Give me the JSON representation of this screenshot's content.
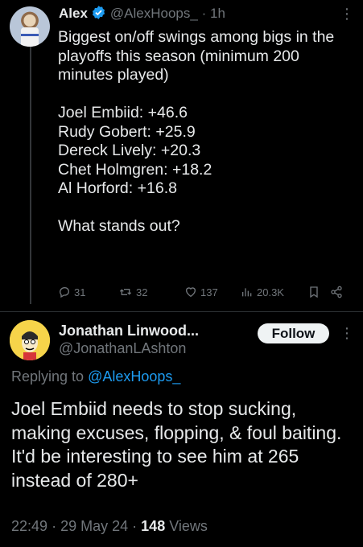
{
  "tweet": {
    "author_name": "Alex",
    "author_handle": "@AlexHoops_",
    "separator": "·",
    "time": "1h",
    "text_intro": "Biggest on/off swings among bigs in the playoffs this season (minimum 200 minutes played)",
    "list": [
      "Joel Embiid: +46.6",
      "Rudy Gobert: +25.9",
      "Dereck Lively: +20.3",
      "Chet Holmgren: +18.2",
      "Al Horford: +16.8"
    ],
    "text_outro": "What stands out?",
    "stats": {
      "replies": "31",
      "reposts": "32",
      "likes": "137",
      "views": "20.3K"
    }
  },
  "reply": {
    "author_name": "Jonathan Linwood...",
    "author_handle": "@JonathanLAshton",
    "follow_label": "Follow",
    "replying_to_prefix": "Replying to ",
    "replying_to_handle": "@AlexHoops_",
    "text": "Joel Embiid needs to stop sucking, making excuses, flopping, & foul baiting. It'd be interesting to see him at 265 instead of 280+",
    "time": "22:49",
    "separator": "·",
    "date": "29 May 24",
    "views_count": "148",
    "views_label": "Views"
  },
  "colors": {
    "background": "#000000",
    "text": "#e7e9ea",
    "secondary": "#71767b",
    "link": "#1d9bf0",
    "verified": "#1d9bf0"
  }
}
